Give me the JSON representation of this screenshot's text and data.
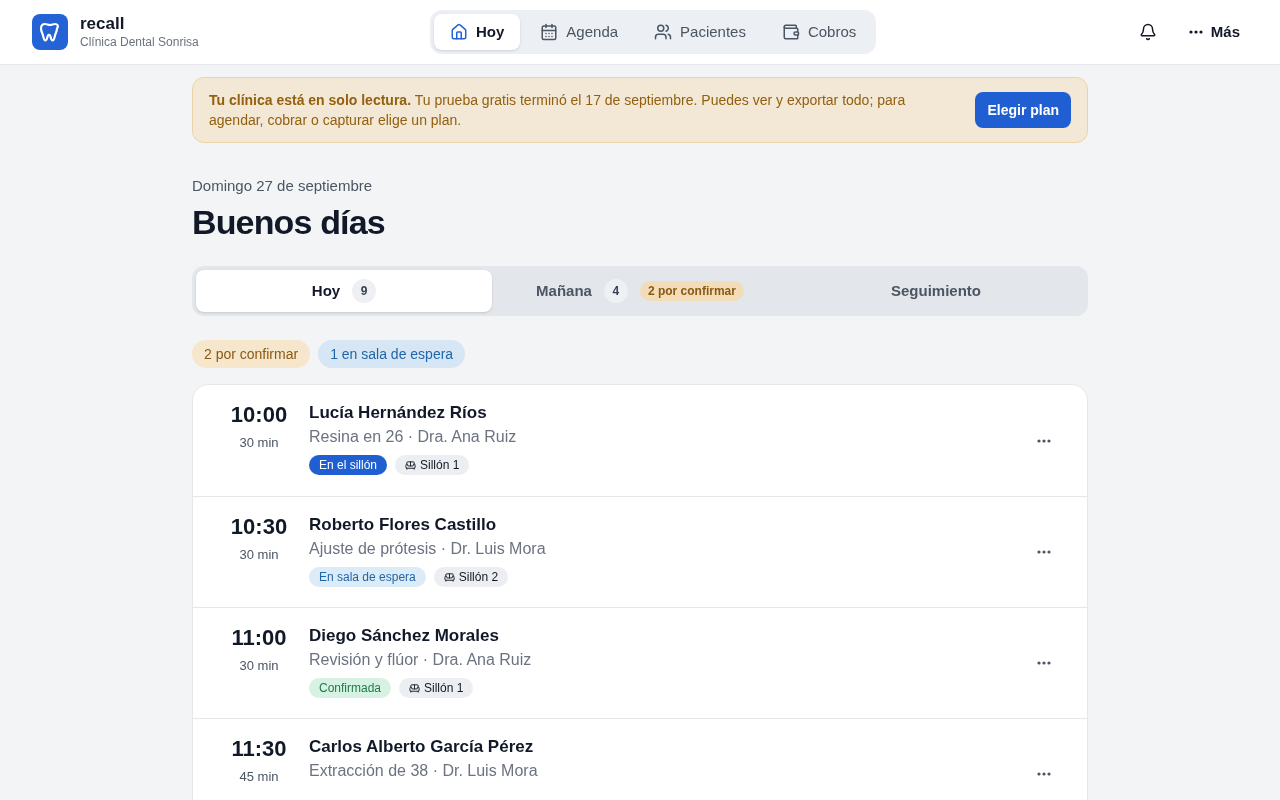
{
  "brand": {
    "name": "recall",
    "clinic": "Clínica Dental Sonrisa"
  },
  "nav": [
    {
      "label": "Hoy",
      "selected": true
    },
    {
      "label": "Agenda",
      "selected": false
    },
    {
      "label": "Pacientes",
      "selected": false
    },
    {
      "label": "Cobros",
      "selected": false
    }
  ],
  "more": "Más",
  "banner": {
    "text": "**Tu clínica está en solo lectura.** Tu prueba gratis terminó el 17 de septiembre. Puedes ver y exportar todo; para agendar, cobrar o capturar elige un plan.",
    "button": "Elegir plan"
  },
  "date": "Domingo 27 de septiembre",
  "greeting": "Buenos días",
  "tabs": [
    {
      "label": "Hoy",
      "count": "9",
      "selected": true
    },
    {
      "label": "Mañana",
      "count": "4",
      "badge": "2 por confirmar",
      "selected": false
    },
    {
      "label": "Seguimiento",
      "selected": false
    }
  ],
  "filters": [
    {
      "label": "2 por confirmar",
      "kind": "pending"
    },
    {
      "label": "1 en sala de espera",
      "kind": "waiting"
    }
  ],
  "appointments": [
    {
      "time": "10:00",
      "duration": "30 min",
      "patient": "Lucía Hernández Ríos",
      "detail": "Resina en 26 · Dra. Ana Ruiz",
      "status": "En el sillón",
      "kind": "in_chair",
      "chair": "Sillón 1"
    },
    {
      "time": "10:30",
      "duration": "30 min",
      "patient": "Roberto Flores Castillo",
      "detail": "Ajuste de prótesis · Dr. Luis Mora",
      "status": "En sala de espera",
      "kind": "waiting",
      "chair": "Sillón 2"
    },
    {
      "time": "11:00",
      "duration": "30 min",
      "patient": "Diego Sánchez Morales",
      "detail": "Revisión y flúor · Dra. Ana Ruiz",
      "status": "Confirmada",
      "kind": "confirmed",
      "chair": "Sillón 1"
    },
    {
      "time": "11:30",
      "duration": "45 min",
      "patient": "Carlos Alberto García Pérez",
      "detail": "Extracción de 38 · Dr. Luis Mora"
    }
  ]
}
